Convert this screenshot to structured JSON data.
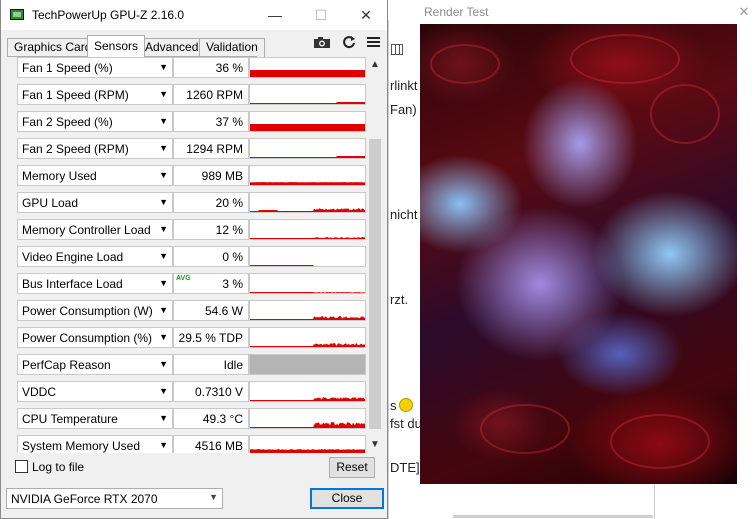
{
  "background_doc": {
    "fragments": [
      "rlinkt",
      "Fan)",
      "nicht",
      "rzt.",
      "s",
      "fst du",
      "DTE]"
    ]
  },
  "render_window": {
    "title": "Render Test",
    "close_glyph": "✕"
  },
  "gpuz": {
    "title": "TechPowerUp GPU-Z 2.16.0",
    "window_buttons": {
      "minimize": "—",
      "maximize": "☐",
      "close": "✕"
    },
    "tabs": [
      "Graphics Card",
      "Sensors",
      "Advanced",
      "Validation"
    ],
    "active_tab": "Sensors",
    "toolbar_icons": [
      "camera-icon",
      "refresh-icon",
      "menu-icon"
    ],
    "accent_color": "#e00000",
    "sensors": [
      {
        "name": "Fan 1 Speed (%)",
        "value": "36 %",
        "graph_level": 0.36
      },
      {
        "name": "Fan 1 Speed (RPM)",
        "value": "1260 RPM",
        "graph_level": 0.1
      },
      {
        "name": "Fan 2 Speed (%)",
        "value": "37 %",
        "graph_level": 0.37
      },
      {
        "name": "Fan 2 Speed (RPM)",
        "value": "1294 RPM",
        "graph_level": 0.1
      },
      {
        "name": "Memory Used",
        "value": "989 MB",
        "graph_level": 0.15
      },
      {
        "name": "GPU Load",
        "value": "20 %",
        "graph_level": 0.2
      },
      {
        "name": "Memory Controller Load",
        "value": "12 %",
        "graph_level": 0.12
      },
      {
        "name": "Video Engine Load",
        "value": "0 %",
        "graph_level": 0
      },
      {
        "name": "Bus Interface Load",
        "value": "3 %",
        "graph_level": 0.05,
        "badge": "AVG"
      },
      {
        "name": "Power Consumption (W)",
        "value": "54.6 W",
        "graph_level": 0.2
      },
      {
        "name": "Power Consumption (%)",
        "value": "29.5 % TDP",
        "graph_level": 0.2
      },
      {
        "name": "PerfCap Reason",
        "value": "Idle",
        "graph_level": 1
      },
      {
        "name": "VDDC",
        "value": "0.7310 V",
        "graph_level": 0.2
      },
      {
        "name": "CPU Temperature",
        "value": "49.3 °C",
        "graph_level": 0.3
      },
      {
        "name": "System Memory Used",
        "value": "4516 MB",
        "graph_level": 0.3
      }
    ],
    "log_to_file_label": "Log to file",
    "reset_label": "Reset",
    "gpu_select_value": "NVIDIA GeForce RTX 2070",
    "close_label": "Close"
  }
}
